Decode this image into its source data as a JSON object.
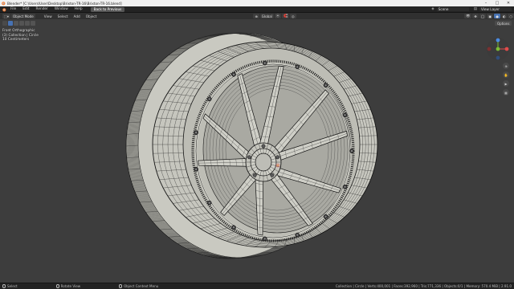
{
  "window": {
    "title": "Blender* [C:\\Users\\User\\Desktop\\Brixton-TR-16\\Brixton-TR-16.blend]"
  },
  "topbar": {
    "menus": [
      "File",
      "Edit",
      "Render",
      "Window",
      "Help"
    ],
    "workspace_tab": "Back to Previous",
    "scene_label": "Scene",
    "view_layer_label": "View Layer"
  },
  "viewport_header": {
    "mode": "Object Mode",
    "menus": [
      "View",
      "Select",
      "Add",
      "Object"
    ],
    "orientation": "Global"
  },
  "overlay": {
    "view_name": "Front Orthographic",
    "collection": "(3) Collection | Circle",
    "units": "10 Centimeters"
  },
  "options_label": "Options",
  "statusbar": {
    "items": [
      "Select",
      "Rotate View",
      "Object Context Menu"
    ],
    "stats": "Collection | Circle | Verts:400,001 | Faces:392,960 | Tris:771,336 | Objects:0/1 | Memory: 570.4 MiB | 2.91.0"
  },
  "colors": {
    "viewport_bg": "#3d3d3d",
    "mesh_face": "#c8c8c0",
    "wire": "#1a1a1a",
    "accent": "#4772b3",
    "axis_x": "#e24b4b",
    "axis_y": "#7bbe33",
    "axis_z": "#4b8be2"
  },
  "icons": [
    "blender-logo-icon",
    "minimize-icon",
    "maximize-icon",
    "close-icon",
    "zoom-icon",
    "hand-icon",
    "camera-icon",
    "grid-icon"
  ]
}
